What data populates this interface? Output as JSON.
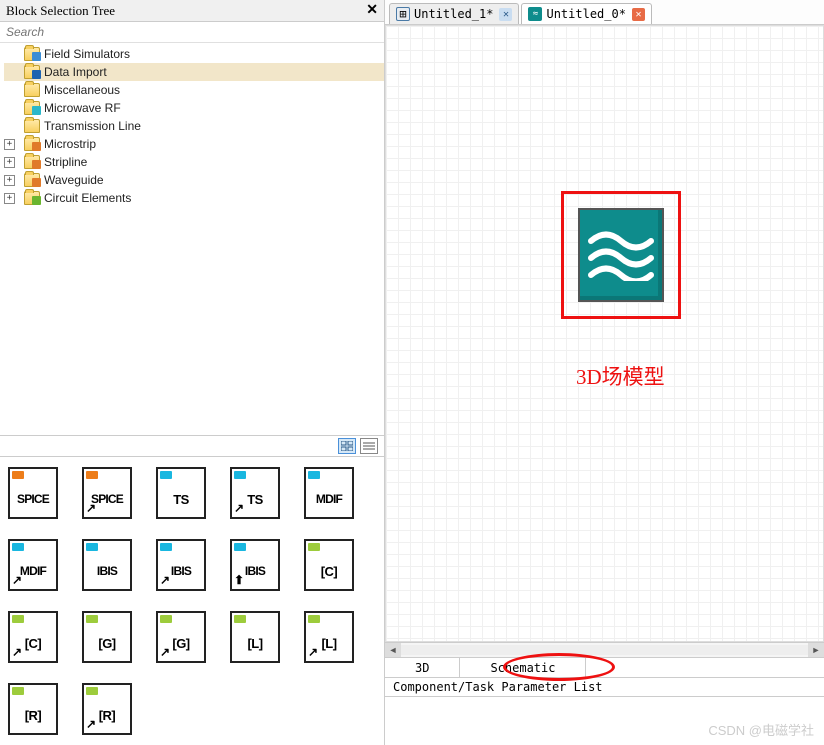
{
  "panel_title": "Block Selection Tree",
  "search_placeholder": "Search",
  "tree": [
    {
      "label": "Field Simulators",
      "accent": "acc-blue",
      "expandable": false
    },
    {
      "label": "Data Import",
      "accent": "acc-deepblue",
      "expandable": false,
      "selected": true
    },
    {
      "label": "Miscellaneous",
      "accent": "",
      "expandable": false
    },
    {
      "label": "Microwave RF",
      "accent": "acc-cyan",
      "expandable": false
    },
    {
      "label": "Transmission Line",
      "accent": "",
      "expandable": false
    },
    {
      "label": "Microstrip",
      "accent": "acc-orange",
      "expandable": true
    },
    {
      "label": "Stripline",
      "accent": "acc-orange",
      "expandable": true
    },
    {
      "label": "Waveguide",
      "accent": "acc-orange",
      "expandable": true
    },
    {
      "label": "Circuit Elements",
      "accent": "acc-green",
      "expandable": true
    }
  ],
  "blocks": [
    {
      "label": "SPICE",
      "flap": "flap-orange",
      "arrow": ""
    },
    {
      "label": "SPICE",
      "flap": "flap-orange",
      "arrow": "↗"
    },
    {
      "label": "TS",
      "flap": "flap-cyan",
      "arrow": ""
    },
    {
      "label": "TS",
      "flap": "flap-cyan",
      "arrow": "↗"
    },
    {
      "label": "MDIF",
      "flap": "flap-cyan",
      "arrow": ""
    },
    {
      "label": "MDIF",
      "flap": "flap-cyan",
      "arrow": "↗"
    },
    {
      "label": "IBIS",
      "flap": "flap-cyan",
      "arrow": ""
    },
    {
      "label": "IBIS",
      "flap": "flap-cyan",
      "arrow": "↗"
    },
    {
      "label": "IBIS",
      "flap": "flap-cyan",
      "arrow": "⬆"
    },
    {
      "label": "[C]",
      "flap": "flap-green",
      "arrow": ""
    },
    {
      "label": "[C]",
      "flap": "flap-green",
      "arrow": "↗"
    },
    {
      "label": "[G]",
      "flap": "flap-green",
      "arrow": ""
    },
    {
      "label": "[G]",
      "flap": "flap-green",
      "arrow": "↗"
    },
    {
      "label": "[L]",
      "flap": "flap-green",
      "arrow": ""
    },
    {
      "label": "[L]",
      "flap": "flap-green",
      "arrow": "↗"
    },
    {
      "label": "[R]",
      "flap": "flap-green",
      "arrow": ""
    },
    {
      "label": "[R]",
      "flap": "flap-green",
      "arrow": "↗"
    }
  ],
  "doc_tabs": [
    {
      "label": "Untitled_1*",
      "icon": "sim",
      "close": "blue",
      "active": false
    },
    {
      "label": "Untitled_0*",
      "icon": "wave",
      "close": "red",
      "active": true
    }
  ],
  "bottom_tabs": {
    "tab1": "3D",
    "tab2": "Schematic"
  },
  "param_header": "Component/Task Parameter List",
  "model_label": "3D场模型",
  "watermark": "CSDN @电磁学社"
}
